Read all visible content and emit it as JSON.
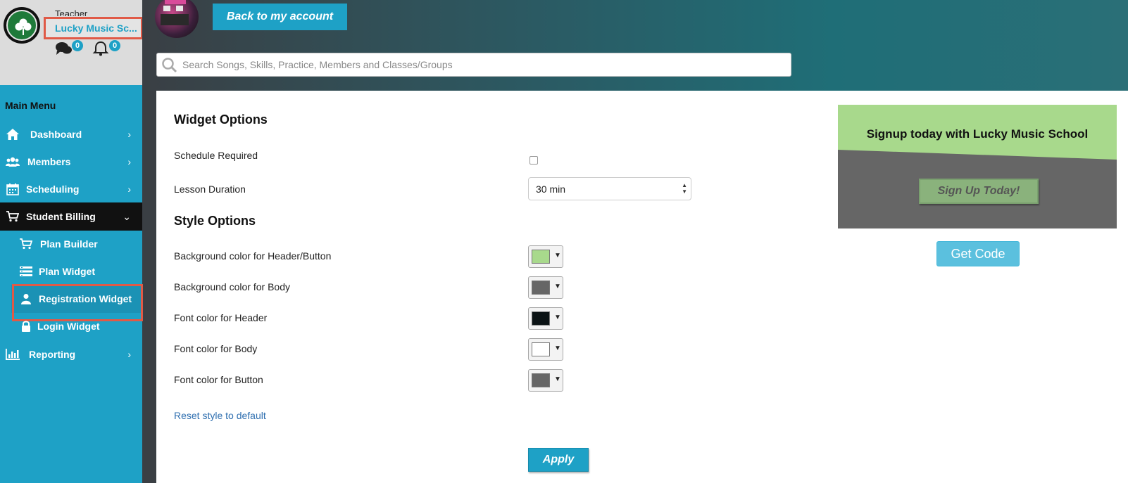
{
  "profile": {
    "role": "Teacher",
    "school_name": "Lucky Music Sc...",
    "messages_count": "0",
    "notifications_count": "0"
  },
  "sidebar": {
    "title": "Main Menu",
    "items": [
      {
        "label": "Dashboard",
        "icon": "home-icon"
      },
      {
        "label": "Members",
        "icon": "users-icon"
      },
      {
        "label": "Scheduling",
        "icon": "calendar-icon"
      },
      {
        "label": "Student Billing",
        "icon": "cart-icon",
        "expanded": true
      },
      {
        "label": "Reporting",
        "icon": "bar-chart-icon"
      }
    ],
    "sub_items": [
      {
        "label": "Plan Builder",
        "icon": "cart-icon"
      },
      {
        "label": "Plan Widget",
        "icon": "list-icon"
      },
      {
        "label": "Registration Widget",
        "icon": "user-icon",
        "selected": true
      },
      {
        "label": "Login Widget",
        "icon": "lock-icon"
      }
    ]
  },
  "header": {
    "back_button": "Back to my account",
    "search_placeholder": "Search Songs, Skills, Practice, Members and Classes/Groups"
  },
  "widget_options": {
    "title": "Widget Options",
    "schedule_required_label": "Schedule Required",
    "schedule_required_checked": false,
    "lesson_duration_label": "Lesson Duration",
    "lesson_duration_value": "30 min"
  },
  "style_options": {
    "title": "Style Options",
    "rows": [
      {
        "label": "Background color for Header/Button",
        "color": "#a8d98c"
      },
      {
        "label": "Background color for Body",
        "color": "#666666"
      },
      {
        "label": "Font color for Header",
        "color": "#0b1315"
      },
      {
        "label": "Font color for Body",
        "color": "#ffffff"
      },
      {
        "label": "Font color for Button",
        "color": "#666666"
      }
    ],
    "reset_link": "Reset style to default",
    "apply_button": "Apply"
  },
  "preview": {
    "title": "Signup today with Lucky Music School",
    "button": "Sign Up Today!"
  },
  "get_code_button": "Get Code",
  "colors": {
    "sidebar": "#1ea1c6",
    "active_menu": "#111111",
    "highlight_border": "#e05a47",
    "accent": "#1ea1c6"
  }
}
